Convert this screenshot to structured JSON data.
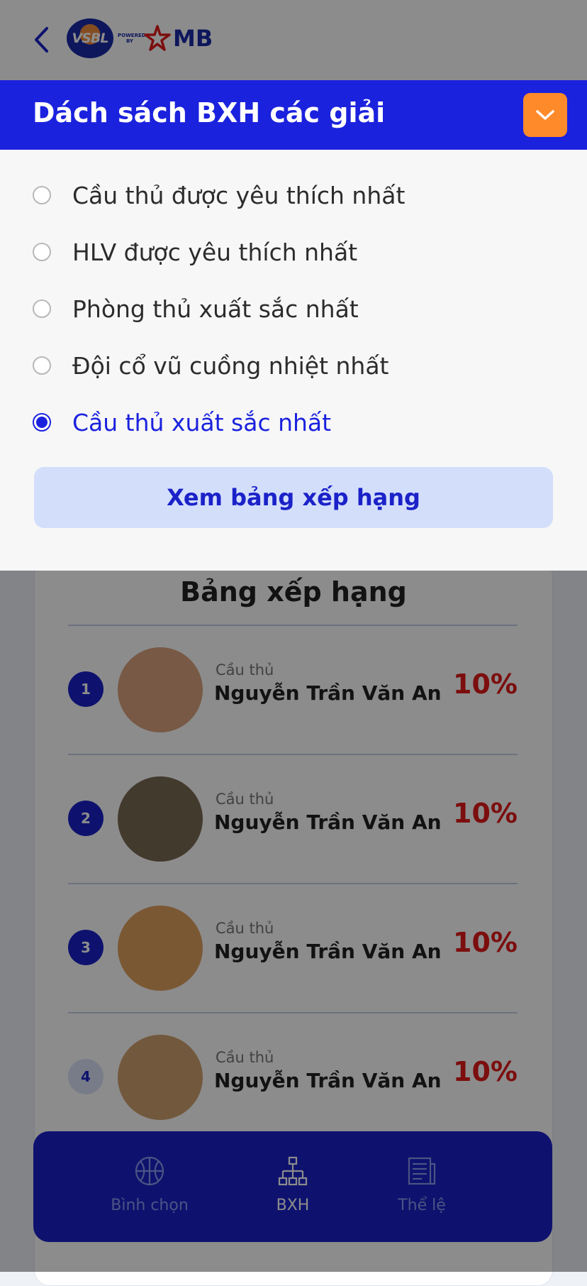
{
  "header": {
    "logo_text": "VSBL",
    "powered_by": "POWERED BY",
    "brand": "MB"
  },
  "sheet": {
    "title": "Dách sách BXH các giải",
    "options": [
      {
        "label": "Cầu thủ được yêu thích nhất",
        "selected": false
      },
      {
        "label": "HLV được yêu thích nhất",
        "selected": false
      },
      {
        "label": "Phòng thủ xuất sắc nhất",
        "selected": false
      },
      {
        "label": "Đội cổ vũ cuồng nhiệt nhất",
        "selected": false
      },
      {
        "label": "Cầu thủ xuất sắc nhất",
        "selected": true
      }
    ],
    "view_button": "Xem bảng xếp hạng"
  },
  "ranking": {
    "title": "Bảng xếp hạng",
    "rows": [
      {
        "rank": "1",
        "label": "Cầu thủ",
        "name": "Nguyễn Trần Văn An",
        "percent": "10%"
      },
      {
        "rank": "2",
        "label": "Cầu thủ",
        "name": "Nguyễn Trần Văn An",
        "percent": "10%"
      },
      {
        "rank": "3",
        "label": "Cầu thủ",
        "name": "Nguyễn Trần Văn An",
        "percent": "10%"
      },
      {
        "rank": "4",
        "label": "Cầu thủ",
        "name": "Nguyễn Trần Văn An",
        "percent": "10%"
      }
    ]
  },
  "nav": {
    "items": [
      {
        "label": "Bình chọn",
        "icon": "basketball-icon",
        "active": false
      },
      {
        "label": "BXH",
        "icon": "hierarchy-icon",
        "active": true
      },
      {
        "label": "Thể lệ",
        "icon": "newspaper-icon",
        "active": false
      }
    ]
  },
  "colors": {
    "primary": "#1b22dd",
    "accent": "#ff8a2a",
    "percent": "#e21b1b"
  }
}
